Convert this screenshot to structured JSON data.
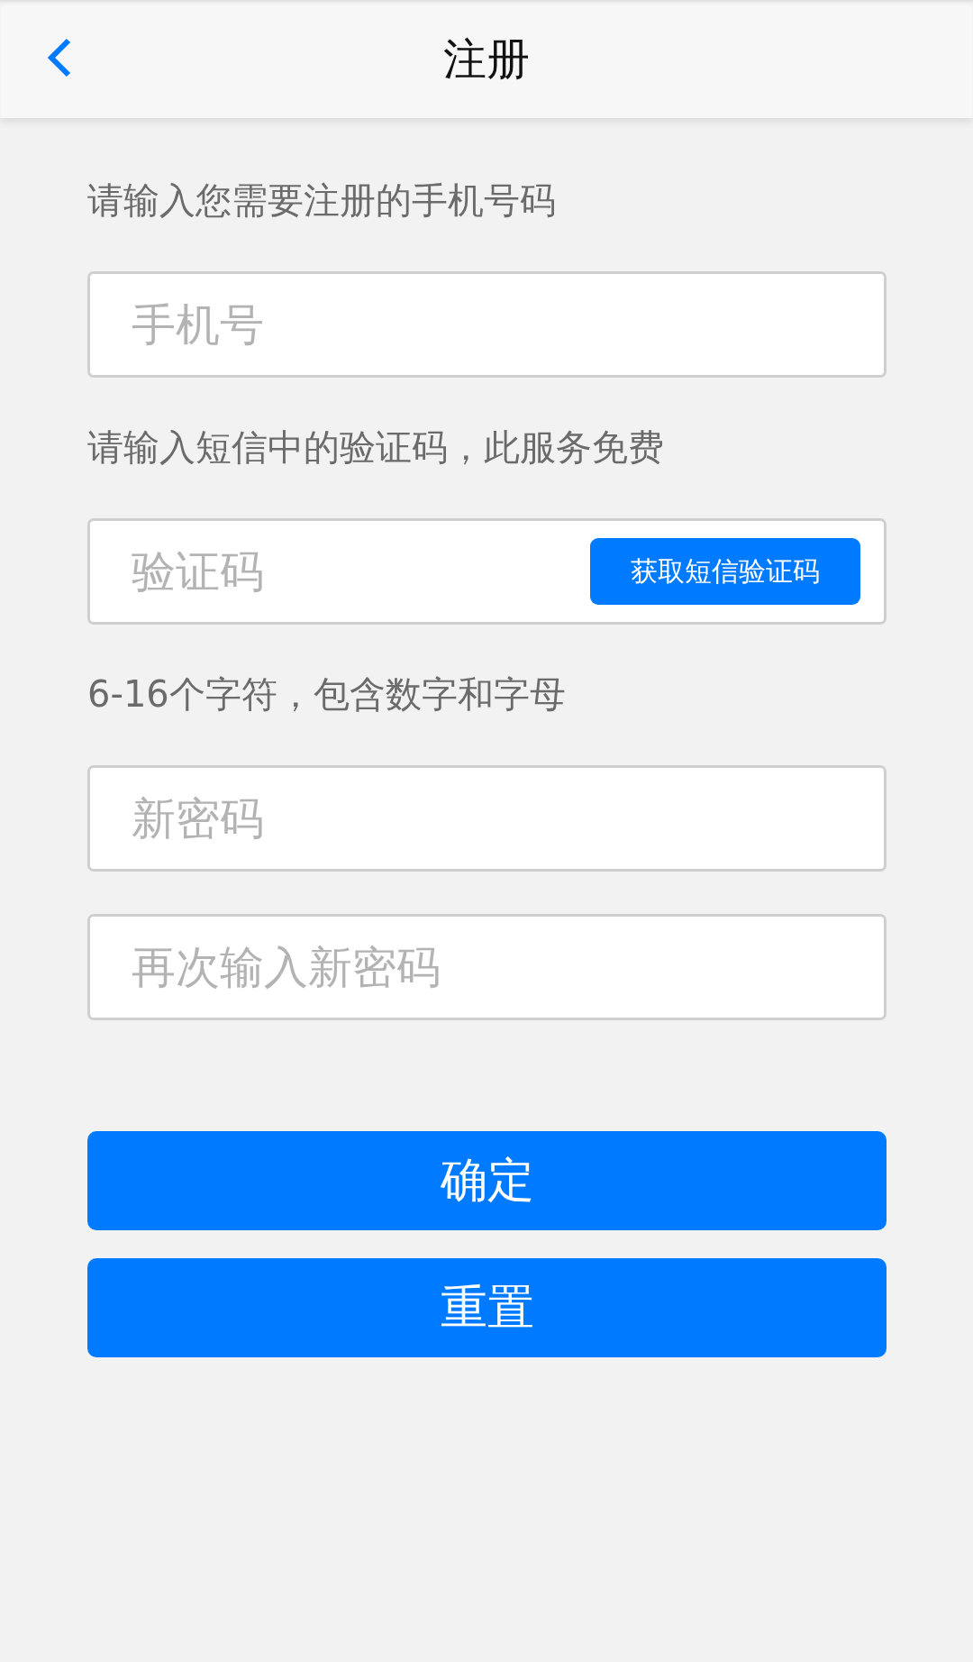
{
  "header": {
    "title": "注册"
  },
  "form": [
    {
      "kind": "label",
      "text": "请输入您需要注册的手机号码"
    },
    {
      "kind": "field",
      "placeholder": "手机号"
    },
    {
      "kind": "label",
      "text": "请输入短信中的验证码，此服务免费"
    },
    {
      "kind": "field_with_button",
      "placeholder": "验证码",
      "button": "获取短信验证码"
    },
    {
      "kind": "label",
      "text": "6-16个字符，包含数字和字母"
    },
    {
      "kind": "field",
      "placeholder": "新密码"
    },
    {
      "kind": "field",
      "placeholder": "再次输入新密码"
    }
  ],
  "buttons": [
    "确定",
    "重置"
  ]
}
